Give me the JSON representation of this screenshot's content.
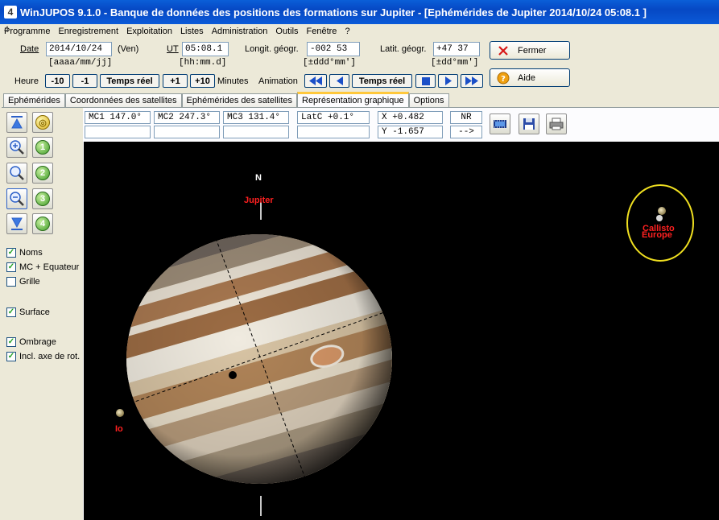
{
  "window": {
    "title": "WinJUPOS 9.1.0 - Banque de données des positions des formations sur Jupiter - [Ephémérides de Jupiter  2014/10/24  05:08.1 ]"
  },
  "menu": [
    "Programme",
    "Enregistrement",
    "Exploitation",
    "Listes",
    "Administration",
    "Outils",
    "Fenêtre",
    "?"
  ],
  "form": {
    "date_label": "Date",
    "date_value": "2014/10/24",
    "date_day": "(Ven)",
    "date_hint": "[aaaa/mm/jj]",
    "ut_label": "UT",
    "ut_value": "05:08.1",
    "ut_hint": "[hh:mm.d]",
    "long_label": "Longit. géogr.",
    "long_value": "-002 53",
    "long_hint": "[±ddd°mm']",
    "lat_label": "Latit. géogr.",
    "lat_value": "+47 37",
    "lat_hint": "[±dd°mm']"
  },
  "controls": {
    "heure_label": "Heure",
    "minus10": "-10",
    "minus1": "-1",
    "realtime": "Temps réel",
    "plus1": "+1",
    "plus10": "+10",
    "minutes_label": "Minutes",
    "animation_label": "Animation",
    "anim_realtime": "Temps réel"
  },
  "buttons": {
    "close": "Fermer",
    "help": "Aide"
  },
  "tabs": [
    "Ephémérides",
    "Coordonnées des satellites",
    "Ephémérides des satellites",
    "Représentation graphique",
    "Options"
  ],
  "active_tab": "Représentation graphique",
  "info": {
    "mc1": "MC1 147.0°",
    "mc2": "MC2 247.3°",
    "mc3": "MC3 131.4°",
    "latc": "LatC  +0.1°",
    "x": "X   +0.482",
    "y": "Y   -1.657",
    "nr": "NR",
    "arrow": "-->"
  },
  "left_buttons": {
    "numbers": [
      "1",
      "2",
      "3",
      "4"
    ]
  },
  "checkboxes": [
    {
      "label": "Noms",
      "checked": true
    },
    {
      "label": "MC + Equateur",
      "checked": true
    },
    {
      "label": "Grille",
      "checked": false
    },
    {
      "label": "Surface",
      "checked": true
    },
    {
      "label": "Ombrage",
      "checked": true
    },
    {
      "label": "Incl. axe de rot.",
      "checked": true
    }
  ],
  "sky": {
    "north": "N",
    "jupiter": "Jupiter",
    "io": "Io",
    "callisto": "Callisto",
    "europe": "Europe",
    "colors": {
      "label": "#ff2020",
      "highlight_ring": "#f0e020",
      "background": "#000000"
    }
  }
}
